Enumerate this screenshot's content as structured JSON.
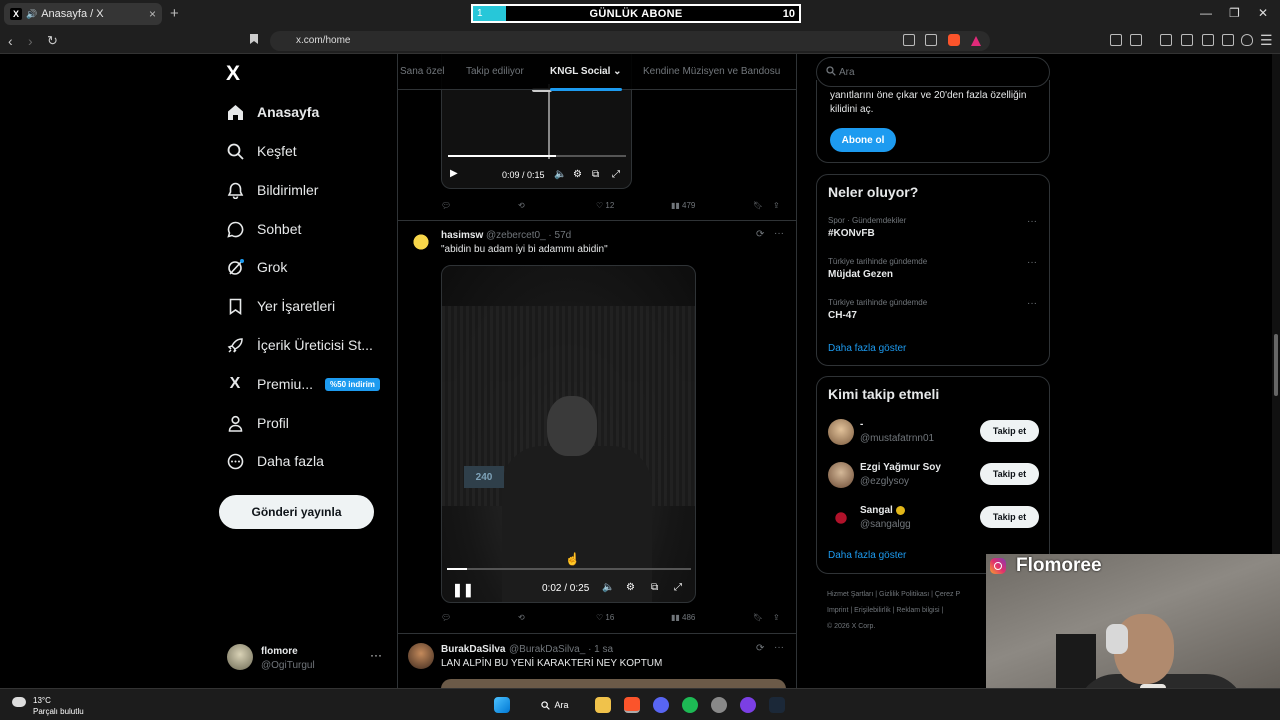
{
  "browser": {
    "tab_title": "Anasayfa / X",
    "tab_favicon": "X",
    "new_tab": "+",
    "url": "x.com/home"
  },
  "subscriber_bar": {
    "current": "1",
    "label": "GÜNLÜK ABONE",
    "goal": "10",
    "progress_fraction": 0.1,
    "color": "#27c7d9"
  },
  "sidebar": {
    "logo": "X",
    "items": [
      {
        "label": "Anasayfa",
        "icon": "home-icon",
        "active": true
      },
      {
        "label": "Keşfet",
        "icon": "search-icon"
      },
      {
        "label": "Bildirimler",
        "icon": "bell-icon"
      },
      {
        "label": "Sohbet",
        "icon": "chat-icon"
      },
      {
        "label": "Grok",
        "icon": "grok-icon"
      },
      {
        "label": "Yer İşaretleri",
        "icon": "bookmark-icon"
      },
      {
        "label": "İçerik Üreticisi St...",
        "icon": "rocket-icon"
      },
      {
        "label": "Premiu...",
        "icon": "x-icon",
        "badge": "%50 indirim"
      },
      {
        "label": "Profil",
        "icon": "person-icon"
      },
      {
        "label": "Daha fazla",
        "icon": "more-circle-icon"
      }
    ],
    "post_button": "Gönderi yayınla",
    "account": {
      "name": "flomore",
      "handle": "@OgiTurgul",
      "more": "···"
    }
  },
  "feed_tabs": [
    {
      "label": "Sana özel"
    },
    {
      "label": "Takip ediliyor"
    },
    {
      "label": "KNGL Social ⌄",
      "active": true
    },
    {
      "label": "Kendine Müzisyen ve Bandosu"
    }
  ],
  "tweets": [
    {
      "video": {
        "time": "0:09 / 0:15"
      },
      "actions": {
        "replies": "",
        "retweets": "",
        "likes": "12",
        "views": "479"
      }
    },
    {
      "name": "hasimsw",
      "handle": "@zebercet0_ · 57d",
      "text": "\"abidin bu adam iyi bi adammı abidin\"",
      "video": {
        "time": "0:02 / 0:25",
        "sign": "240",
        "progress_fraction": 0.08
      },
      "actions": {
        "replies": "",
        "retweets": "",
        "likes": "16",
        "views": "486"
      }
    },
    {
      "name": "BurakDaSilva",
      "handle": "@BurakDaSilva_ · 1 sa",
      "text": "LAN ALPİN BU YENİ KARAKTERİ NEY KOPTUM"
    }
  ],
  "right": {
    "search_placeholder": "Ara",
    "premium_text_1": "yanıtlarını öne çıkar ve 20'den fazla özelliğin",
    "premium_text_2": "kilidini aç.",
    "subscribe_button": "Abone ol",
    "trends_title": "Neler oluyor?",
    "trends": [
      {
        "category": "Spor · Gündemdekiler",
        "name": "#KONvFB"
      },
      {
        "category": "Türkiye tarihinde gündemde",
        "name": "Müjdat Gezen"
      },
      {
        "category": "Türkiye tarihinde gündemde",
        "name": "CH-47"
      }
    ],
    "trends_more": "Daha fazla göster",
    "follow_title": "Kimi takip etmeli",
    "follow": [
      {
        "name": "-",
        "handle": "@mustafatrnn01",
        "button": "Takip et"
      },
      {
        "name": "Ezgi Yağmur Soy",
        "handle": "@ezglysoy",
        "button": "Takip et"
      },
      {
        "name": "Sangal",
        "handle": "@sangalgg",
        "button": "Takip et",
        "verified": true
      }
    ],
    "follow_more": "Daha fazla göster",
    "footer_line1": "Hizmet Şartları  |  Gizlilik Politikası  |  Çerez P",
    "footer_line2": "Imprint  |  Erişilebilirlik  |  Reklam bilgisi  |",
    "footer_line3": "© 2026 X Corp."
  },
  "webcam": {
    "name": "Flomoree"
  },
  "taskbar": {
    "temp": "13°C",
    "condition": "Parçalı bulutlu",
    "search": "Ara"
  }
}
